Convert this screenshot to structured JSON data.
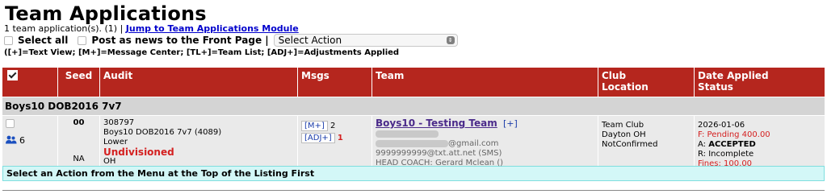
{
  "page": {
    "title": "Team Applications",
    "summary_prefix": "1 team application(s). (1) | ",
    "jump_link": "Jump to Team Applications Module"
  },
  "controls": {
    "select_all": "Select all",
    "post_news": "Post as news to the Front Page |",
    "action_select": "Select Action"
  },
  "legend": "([+]=Text View; [M+]=Message Center; [TL+]=Team List; [ADJ+]=Adjustments Applied",
  "table": {
    "headers": {
      "seed": "Seed",
      "audit": "Audit",
      "msgs": "Msgs",
      "team": "Team",
      "club_line1": "Club",
      "club_line2": "Location",
      "date_line1": "Date Applied",
      "date_line2": "Status"
    },
    "group": "Boys10 DOB2016 7v7",
    "row": {
      "users_count": "6",
      "seed": "00",
      "seed_na": "NA",
      "audit_id": "308797",
      "audit_division": "Boys10 DOB2016 7v7 (4089)",
      "audit_level": "Lower",
      "audit_status": "Undivisioned",
      "audit_state": "OH",
      "msg_m_label": "[M+]",
      "msg_m_count": "2",
      "msg_adj_label": "[ADJ+]",
      "msg_adj_count": "1",
      "team_name": "Boys10 - Testing Team",
      "team_text_view": "[+]",
      "email_suffix": "@gmail.com",
      "sms": "9999999999@txt.att.net (SMS)",
      "head_coach": "HEAD COACH: Gerard Mclean ()",
      "club_name": "Team Club",
      "club_location": "Dayton OH",
      "club_status": "NotConfirmed",
      "date_applied": "2026-01-06",
      "pending": "F: Pending 400.00",
      "accept_prefix": "A: ",
      "accept_value": "ACCEPTED",
      "roster": "R: Incomplete",
      "fines": "Fines: 100.00"
    },
    "action_notice": "Select an Action from the Menu at the Top of the Listing First"
  },
  "colors": {
    "header_bg": "#b5261e",
    "group_bg": "#d4d4d4",
    "row_bg": "#eaeaea",
    "notice_bg": "#d3f7f7",
    "alert": "#d42020",
    "link": "#0000cc"
  }
}
